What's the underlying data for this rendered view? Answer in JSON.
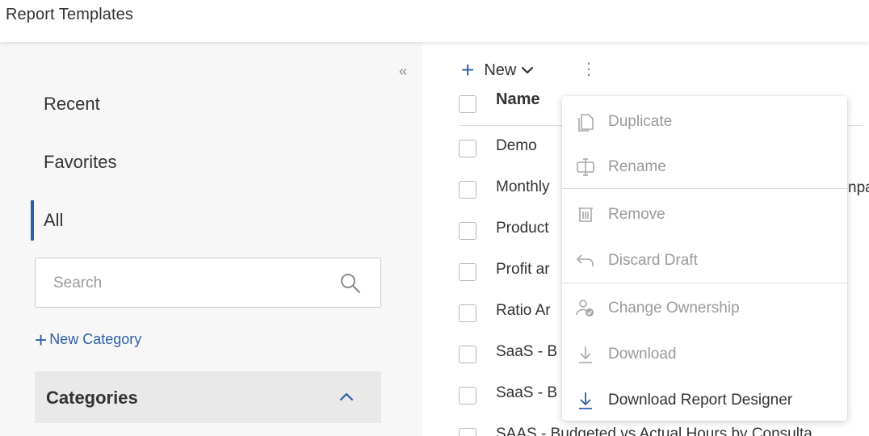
{
  "page": {
    "title": "Report Templates"
  },
  "sidebar": {
    "collapse_glyph": "«",
    "nav": [
      {
        "label": "Recent"
      },
      {
        "label": "Favorites"
      },
      {
        "label": "All",
        "active": true
      }
    ],
    "search": {
      "placeholder": "Search",
      "value": ""
    },
    "new_category": {
      "glyph": "+",
      "label": "New Category"
    },
    "categories": {
      "label": "Categories",
      "expanded": true
    }
  },
  "toolbar": {
    "new_glyph": "+",
    "new_label": "New",
    "more_glyph": "⋮"
  },
  "table": {
    "header": {
      "name": "Name"
    },
    "rows": [
      {
        "name": "Demo"
      },
      {
        "name": "Monthly"
      },
      {
        "name": "Product"
      },
      {
        "name": "Profit ar"
      },
      {
        "name": "Ratio Ar"
      },
      {
        "name": "SaaS - B"
      },
      {
        "name": "SaaS - B"
      },
      {
        "name": "SAAS - Budgeted vs Actual Hours by Consulta"
      }
    ],
    "peek_text": "npa"
  },
  "context_menu": {
    "items": [
      {
        "label": "Duplicate",
        "icon": "copy-icon",
        "enabled": false
      },
      {
        "label": "Rename",
        "icon": "rename-cursor-icon",
        "enabled": false
      },
      {
        "label": "Remove",
        "icon": "trash-icon",
        "enabled": false
      },
      {
        "label": "Discard Draft",
        "icon": "undo-arrow-icon",
        "enabled": false
      },
      {
        "label": "Change Ownership",
        "icon": "change-owner-icon",
        "enabled": false
      },
      {
        "label": "Download",
        "icon": "download-icon",
        "enabled": false
      },
      {
        "label": "Download Report Designer",
        "icon": "download-icon",
        "enabled": true
      }
    ]
  },
  "colors": {
    "accent": "#2f5fa8",
    "disabled_text": "#9a9a9a",
    "text": "#333333",
    "sidebar_bg": "#f7f7f7"
  }
}
